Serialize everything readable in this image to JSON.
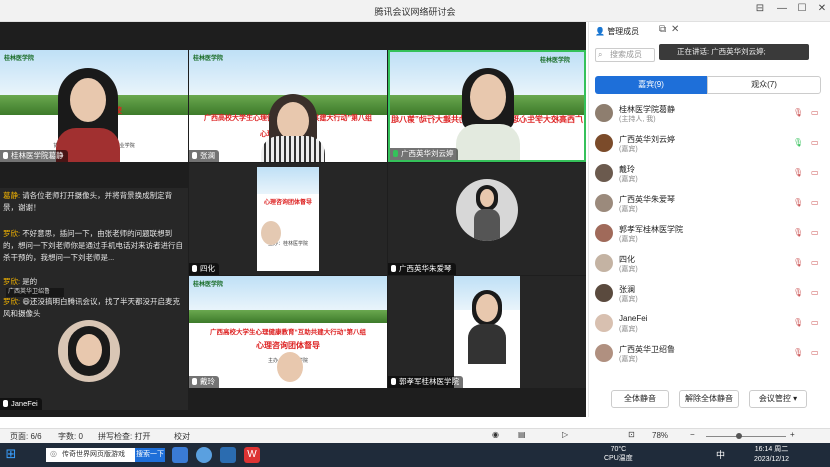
{
  "window": {
    "title": "腾讯会议网络研讨会",
    "controls": [
      "⊟",
      "—",
      "☐",
      "✕"
    ]
  },
  "slides": {
    "header": "桂林医学院",
    "title_line1": "广西高校大学生心理健康教育“互助共建大行动”第八组",
    "title_line2": "心理咨询团体督导",
    "partial_left": "育互助共建高校",
    "partial_left2": "心理督导",
    "organizer": "主办：桂林医学院",
    "co1": "协办：北部湾大学 广西国际职业学院",
    "co2": "钦州幼儿师范高等专科学校 防城港职业技术学院",
    "right_logo": "桂林医学院"
  },
  "tiles": [
    {
      "name": "桂林医学院葛静"
    },
    {
      "name": "张澜"
    },
    {
      "name": "广西英华刘云婷",
      "speaking": true
    },
    {
      "name": "四化"
    },
    {
      "name": "广西英华朱爱琴"
    },
    {
      "name": "JaneFei"
    },
    {
      "name": "戴玲"
    },
    {
      "name": "郭孝军桂林医学院"
    }
  ],
  "chat": [
    {
      "who": "葛静:",
      "text": "请各位老师打开摄像头，并将背景换成制定背景，谢谢！"
    },
    {
      "who": "罗欣:",
      "text": "不好意思，插问一下，由张老师的问题联想到的，想问一下刘老师你是通过手机电话对来访者进行自杀干预的，我想问一下刘老师是..."
    },
    {
      "who": "罗欣:",
      "text": "是的"
    },
    {
      "who": "罗欣:",
      "text": "还没搞明白腾讯会议，找了半天都没开启麦克风和摄像头",
      "emoji": "😄"
    }
  ],
  "chat_overlay": "广西英华卫绍鲁",
  "panel": {
    "title": "管理成员",
    "speaking_label": "正在讲话:",
    "speaking_name": "广西英华刘云婷;",
    "search_placeholder": "搜索成员",
    "tab_active": "嘉宾(9)",
    "tab_inactive": "观众(7)",
    "members": [
      {
        "name": "桂林医学院葛静",
        "role": "(主持人, 我)"
      },
      {
        "name": "广西英华刘云婷",
        "role": "(嘉宾)",
        "speaking": true
      },
      {
        "name": "戴玲",
        "role": "(嘉宾)"
      },
      {
        "name": "广西英华朱爱琴",
        "role": "(嘉宾)"
      },
      {
        "name": "郭孝军桂林医学院",
        "role": "(嘉宾)"
      },
      {
        "name": "四化",
        "role": "(嘉宾)"
      },
      {
        "name": "张澜",
        "role": "(嘉宾)"
      },
      {
        "name": "JaneFei",
        "role": "(嘉宾)"
      },
      {
        "name": "广西英华卫绍鲁",
        "role": "(嘉宾)"
      }
    ],
    "buttons": [
      "全体静音",
      "解除全体静音",
      "会议管控"
    ]
  },
  "statusbar": {
    "page": "页面: 6/6",
    "words": "字数: 0",
    "spell": "拼写检查: 打开",
    "proof": "校对",
    "zoom": "78%",
    "minus": "−",
    "plus": "+"
  },
  "taskbar": {
    "search_text": "传奇世界网页版游戏",
    "search_btn": "搜索一下",
    "temp": "70°C",
    "temp_label": "CPU温度",
    "ime": "中",
    "time": "16:14 周二",
    "date": "2023/12/12"
  }
}
